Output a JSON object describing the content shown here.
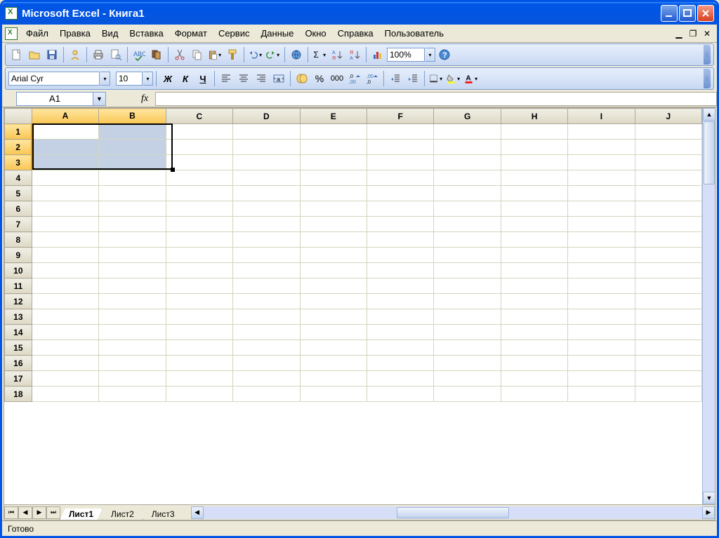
{
  "window": {
    "title": "Microsoft Excel - Книга1"
  },
  "menu": {
    "items": [
      "Файл",
      "Правка",
      "Вид",
      "Вставка",
      "Формат",
      "Сервис",
      "Данные",
      "Окно",
      "Справка",
      "Пользователь"
    ]
  },
  "formatting": {
    "font_name": "Arial Cyr",
    "font_size": "10",
    "bold": "Ж",
    "italic": "К",
    "underline": "Ч",
    "percent": "%",
    "thousands": "000"
  },
  "standard": {
    "zoom": "100%"
  },
  "namebox": {
    "value": "A1",
    "fx": "fx"
  },
  "grid": {
    "columns": [
      "A",
      "B",
      "C",
      "D",
      "E",
      "F",
      "G",
      "H",
      "I",
      "J"
    ],
    "rows": [
      "1",
      "2",
      "3",
      "4",
      "5",
      "6",
      "7",
      "8",
      "9",
      "10",
      "11",
      "12",
      "13",
      "14",
      "15",
      "16",
      "17",
      "18"
    ],
    "selected_cols": [
      "A",
      "B"
    ],
    "selected_rows": [
      "1",
      "2",
      "3"
    ],
    "active_cell": "A1",
    "col_widths": {
      "A": 100,
      "B": 100,
      "default": 100
    }
  },
  "sheets": {
    "tabs": [
      "Лист1",
      "Лист2",
      "Лист3"
    ],
    "active": 0
  },
  "status": {
    "text": "Готово"
  }
}
